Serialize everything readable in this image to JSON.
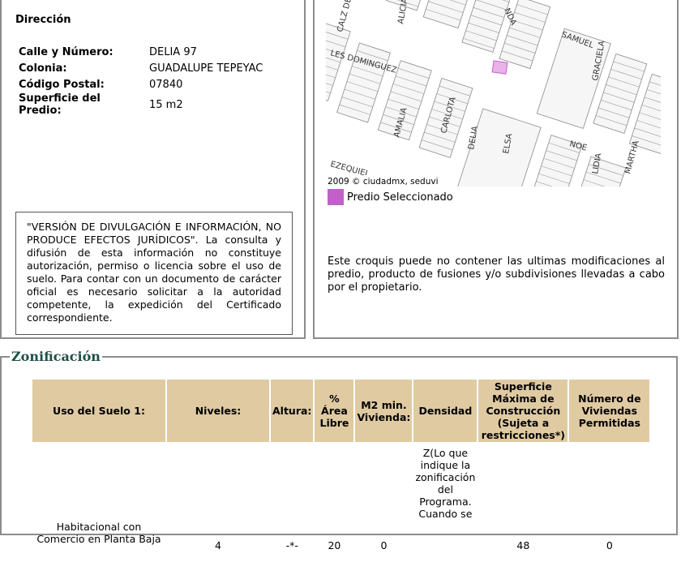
{
  "direccion": {
    "title": "Dirección",
    "rows": [
      {
        "k": "Calle y Número:",
        "v": "DELIA 97"
      },
      {
        "k": "Colonia:",
        "v": "GUADALUPE TEPEYAC"
      },
      {
        "k": "Código Postal:",
        "v": "07840"
      },
      {
        "k": "Superficie del Predio:",
        "v": "15 m2"
      }
    ],
    "disclaimer": "\"VERSIÓN DE DIVULGACIÓN E INFORMACIÓN, NO PRODUCE EFECTOS JURÍDICOS\". La consulta y difusión de esta información no constituye autorización, permiso o licencia sobre el uso de suelo. Para contar con un documento de carácter oficial es necesario solicitar a la autoridad competente, la expedición del Certificado correspondiente."
  },
  "map": {
    "copyright": "2009 © ciudadmx, seduvi",
    "legend": "Predio Seleccionado",
    "highlight_color": "#c35fc9",
    "streets": [
      "CALZ DE",
      "ALICIA",
      "NDA",
      "SAMUEL",
      "LES DOMINGUEZ",
      "GRACIELA",
      "AMALIA",
      "CARLOTA",
      "DELIA",
      "ELSA",
      "NOE",
      "LIDIA",
      "MARTHA",
      "EZEQUIEL"
    ],
    "note": "Este croquis puede no contener las ultimas modificaciones al predio, producto de fusiones y/o subdivisiones llevadas a cabo por el propietario."
  },
  "zonificacion": {
    "title": "Zonificación",
    "headers": [
      "Uso del Suelo 1:",
      "Niveles:",
      "Altura:",
      "% Área Libre",
      "M2 min. Vivienda:",
      "Densidad",
      "Superficie Máxima de Construcción (Sujeta a restricciones*)",
      "Número de Viviendas Permitidas"
    ],
    "row": [
      "Habitacional con Comercio en Planta Baja",
      "4",
      "-*-",
      "20",
      "0",
      "Z(Lo que indique la zonificación del Programa. Cuando se",
      "48",
      "0"
    ]
  }
}
